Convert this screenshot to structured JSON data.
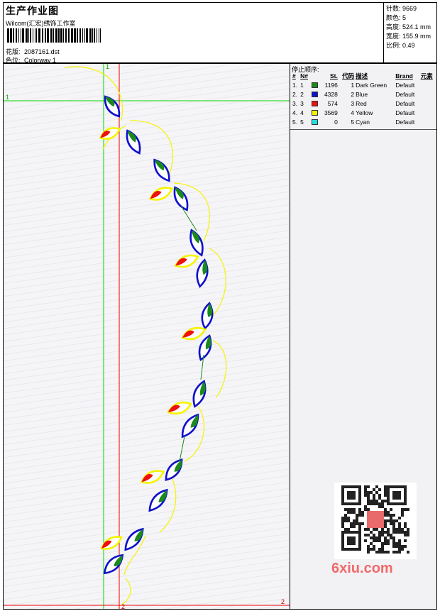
{
  "header": {
    "title": "生产作业图",
    "company": "Wilcom(汇宏)绣饰工作室",
    "design_label": "花版:",
    "design_value": "2087161.dst",
    "colorway_label": "色位:",
    "colorway_value": "Colorway 1"
  },
  "stats": [
    {
      "label": "针数:",
      "value": "9669"
    },
    {
      "label": "颜色:",
      "value": "5"
    },
    {
      "label": "高度:",
      "value": "524.1 mm"
    },
    {
      "label": "宽度:",
      "value": "155.9 mm"
    },
    {
      "label": "比例:",
      "value": "0.49"
    }
  ],
  "stop_sequence": {
    "title": "停止顺序:",
    "columns": [
      "#",
      "N#",
      "St.",
      "代码",
      "描述",
      "Brand",
      "元素"
    ],
    "rows": [
      {
        "n": "1.",
        "nn": "1",
        "color": "#1a8a1a",
        "stitches": "1196",
        "code": "1",
        "desc": "Dark Green",
        "brand": "Default"
      },
      {
        "n": "2.",
        "nn": "2",
        "color": "#1010cc",
        "stitches": "4328",
        "code": "2",
        "desc": "Blue",
        "brand": "Default"
      },
      {
        "n": "3.",
        "nn": "3",
        "color": "#ee1010",
        "stitches": "574",
        "code": "3",
        "desc": "Red",
        "brand": "Default"
      },
      {
        "n": "4.",
        "nn": "4",
        "color": "#f4f400",
        "stitches": "3569",
        "code": "4",
        "desc": "Yellow",
        "brand": "Default"
      },
      {
        "n": "5.",
        "nn": "5",
        "color": "#22dddd",
        "stitches": "0",
        "code": "5",
        "desc": "Cyan",
        "brand": "Default"
      }
    ]
  },
  "guides": {
    "green_h": "1",
    "green_v": "1",
    "red_h": "2",
    "red_v": "2"
  },
  "watermark": "6xiu.com",
  "colors": {
    "dark_green": "#1a8a1a",
    "blue": "#1010cc",
    "red": "#ee1010",
    "yellow": "#f4f400",
    "guide_green": "#00dd00",
    "guide_red": "#ee0000"
  }
}
